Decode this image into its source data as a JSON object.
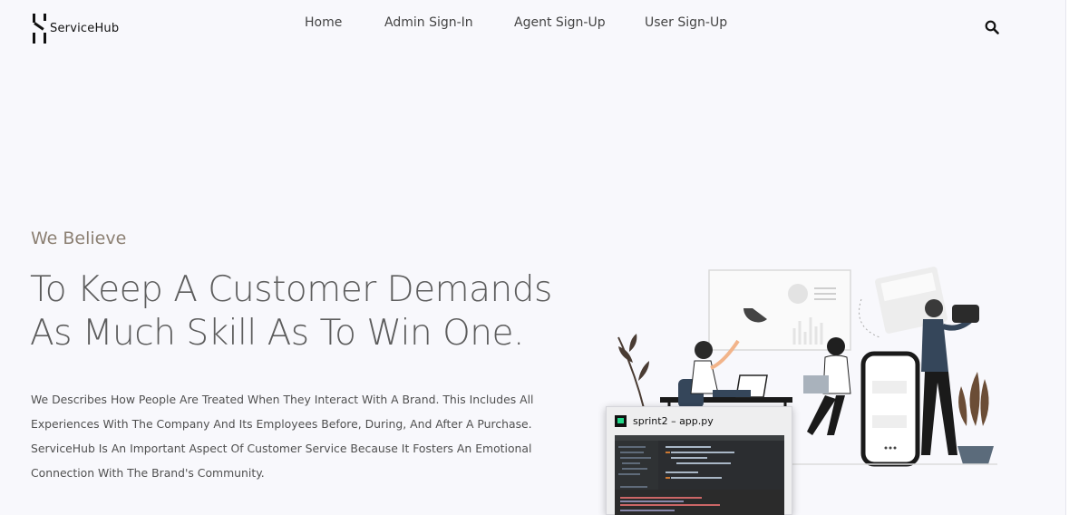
{
  "header": {
    "logo_text": "ServiceHub",
    "nav": [
      {
        "label": "Home"
      },
      {
        "label": "Admin Sign-In"
      },
      {
        "label": "Agent Sign-Up"
      },
      {
        "label": "User Sign-Up"
      }
    ],
    "search_icon": "search-icon"
  },
  "hero": {
    "eyebrow": "We Believe",
    "headline_line1": "To Keep A Customer Demands",
    "headline_line2": "As Much Skill As To Win One.",
    "description": "We Describes How People Are Treated When They Interact With A Brand. This Includes All Experiences With The Company And Its Employees Before, During, And After A Purchase. ServiceHub Is An Important Aspect Of Customer Service Because It Fosters An Emotional Connection With The Brand's Community."
  },
  "taskbar_preview": {
    "title": "sprint2 – app.py",
    "icon": "pycharm-icon"
  },
  "colors": {
    "background": "#f8f8fc",
    "eyebrow": "#8c8073",
    "headline": "#5d5d5d",
    "accent_dark": "#35465a"
  }
}
